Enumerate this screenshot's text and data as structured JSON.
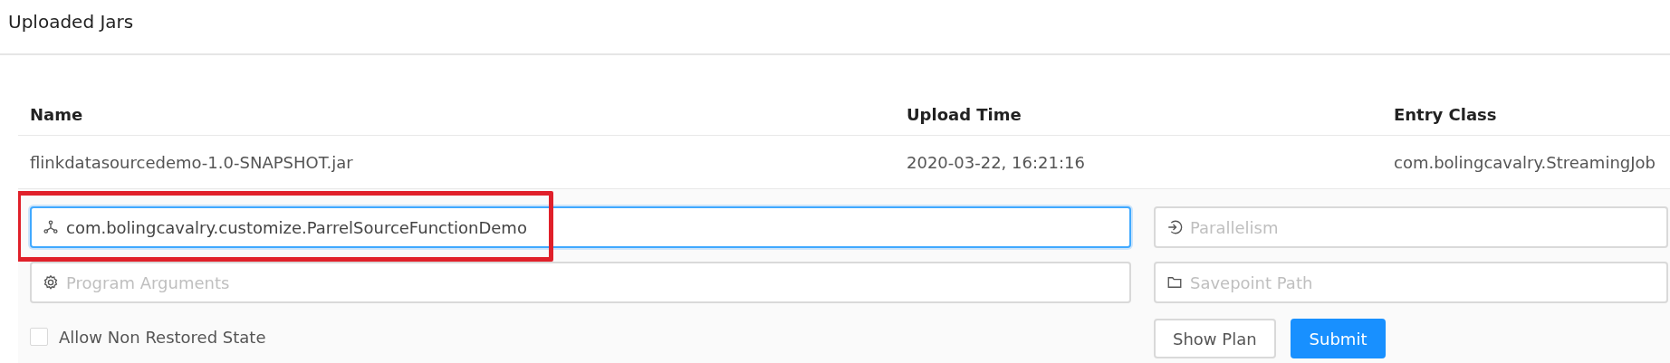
{
  "page": {
    "title": "Uploaded Jars"
  },
  "table": {
    "columns": [
      "Name",
      "Upload Time",
      "Entry Class"
    ],
    "rows": [
      {
        "cells": [
          "flinkdatasourcedemo-1.0-SNAPSHOT.jar",
          "2020-03-22, 16:21:16",
          "com.bolingcavalry.StreamingJob"
        ],
        "expanded": true
      }
    ]
  },
  "form": {
    "entry_class": {
      "value": "com.bolingcavalry.customize.ParrelSourceFunctionDemo",
      "focused": true,
      "highlighted": true
    },
    "parallelism": {
      "placeholder": "Parallelism"
    },
    "program_arguments": {
      "placeholder": "Program Arguments"
    },
    "savepoint_path": {
      "placeholder": "Savepoint Path"
    },
    "allow_non_restored_state": {
      "label": "Allow Non Restored State",
      "checked": false
    },
    "buttons": [
      {
        "label": "Show Plan",
        "kind": "default"
      },
      {
        "label": "Submit",
        "kind": "primary"
      }
    ]
  }
}
